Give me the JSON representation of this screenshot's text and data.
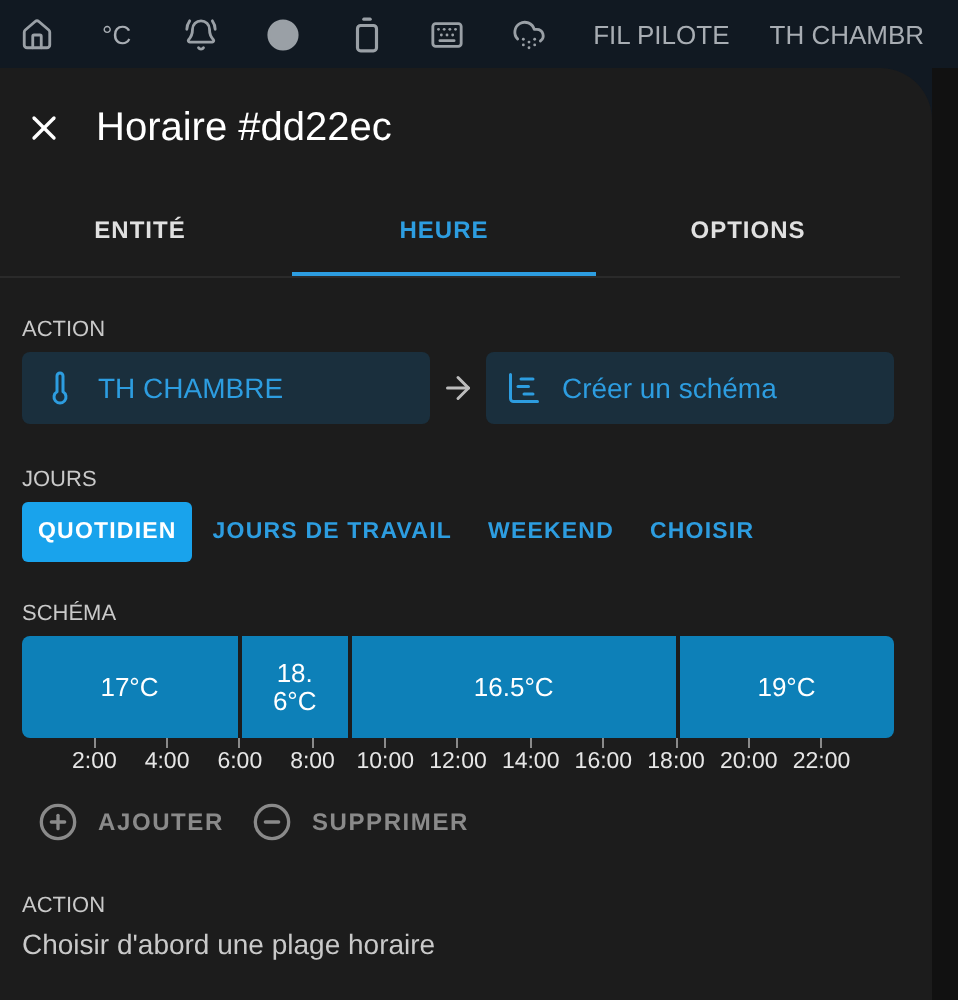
{
  "top_bar": {
    "items": [
      {
        "kind": "icon"
      },
      {
        "kind": "text",
        "label": "°C"
      },
      {
        "kind": "icon"
      },
      {
        "kind": "icon"
      },
      {
        "kind": "icon"
      },
      {
        "kind": "icon"
      },
      {
        "kind": "icon"
      },
      {
        "kind": "text",
        "label": "FIL PILOTE"
      },
      {
        "kind": "text",
        "label": "TH CHAMBR"
      }
    ]
  },
  "dialog": {
    "title": "Horaire #dd22ec",
    "tabs": [
      {
        "label": "ENTITÉ",
        "selected": false
      },
      {
        "label": "HEURE",
        "selected": true
      },
      {
        "label": "OPTIONS",
        "selected": false
      }
    ],
    "action": {
      "heading": "ACTION",
      "entity": "TH CHAMBRE",
      "target": "Créer un schéma"
    },
    "days": {
      "heading": "JOURS",
      "options": [
        {
          "label": "QUOTIDIEN",
          "selected": true
        },
        {
          "label": "JOURS DE TRAVAIL",
          "selected": false
        },
        {
          "label": "WEEKEND",
          "selected": false
        },
        {
          "label": "CHOISIR",
          "selected": false
        }
      ]
    },
    "schema": {
      "heading": "SCHÉMA",
      "segments": [
        {
          "label": "17°C"
        },
        {
          "label": "18.\n6°C"
        },
        {
          "label": "16.5°C"
        },
        {
          "label": "19°C"
        }
      ],
      "axis": [
        "2:00",
        "4:00",
        "6:00",
        "8:00",
        "10:00",
        "12:00",
        "14:00",
        "16:00",
        "18:00",
        "20:00",
        "22:00"
      ],
      "buttons": [
        {
          "kind": "add",
          "label": "AJOUTER"
        },
        {
          "kind": "remove",
          "label": "SUPPRIMER"
        }
      ]
    },
    "slot_action": {
      "heading": "ACTION",
      "text": "Choisir d'abord une plage horaire"
    }
  }
}
